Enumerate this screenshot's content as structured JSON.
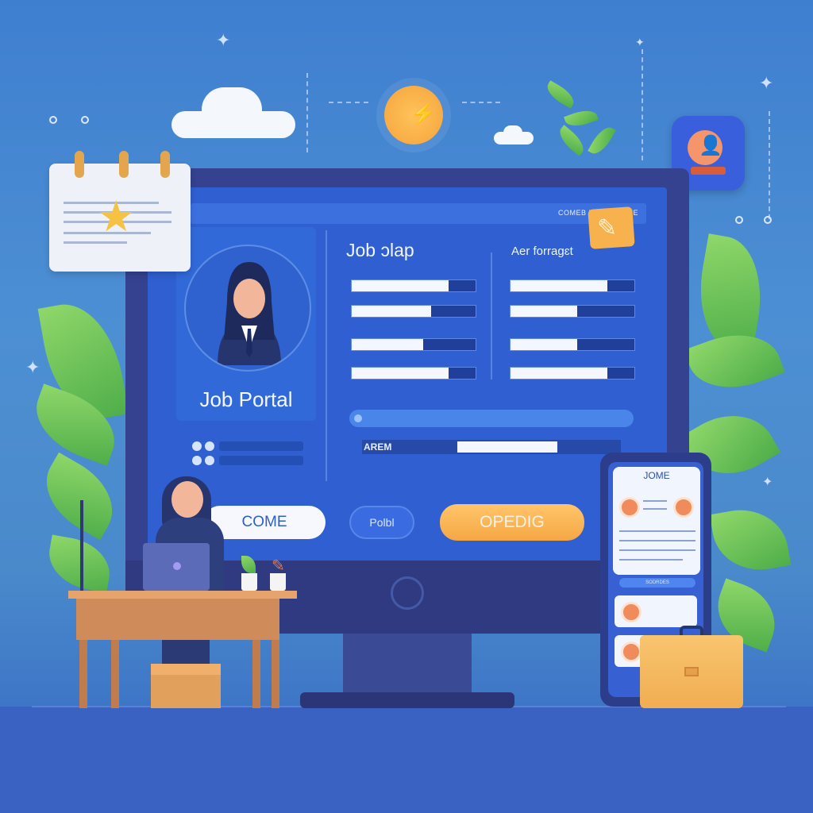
{
  "portal": {
    "title": "Job Portal",
    "topbar_text": "COMEB DNOTMOTNE"
  },
  "content": {
    "heading_left": "Job ɔlap",
    "heading_right": "Aer forragɛt",
    "apply_label": "AREM"
  },
  "buttons": {
    "come": "COME",
    "portal": "Polbl",
    "open": "OPEDIG"
  },
  "phone": {
    "title": "JOME",
    "pill_text": "SODRDES"
  },
  "left_bars": [
    0.78,
    0.64,
    0.58,
    0.78
  ],
  "right_bars": [
    0.78,
    0.54,
    0.54,
    0.78
  ],
  "colors": {
    "screen": "#2f5fd0",
    "accent_orange": "#f6a744",
    "monitor_frame": "#34428f",
    "leaf_green": "#4fae4a"
  },
  "icons": {
    "calendar": "calendar-star-icon",
    "clock": "clock-icon",
    "badge": "user-badge-icon",
    "note": "note-pencil-icon",
    "briefcase": "briefcase-icon"
  }
}
